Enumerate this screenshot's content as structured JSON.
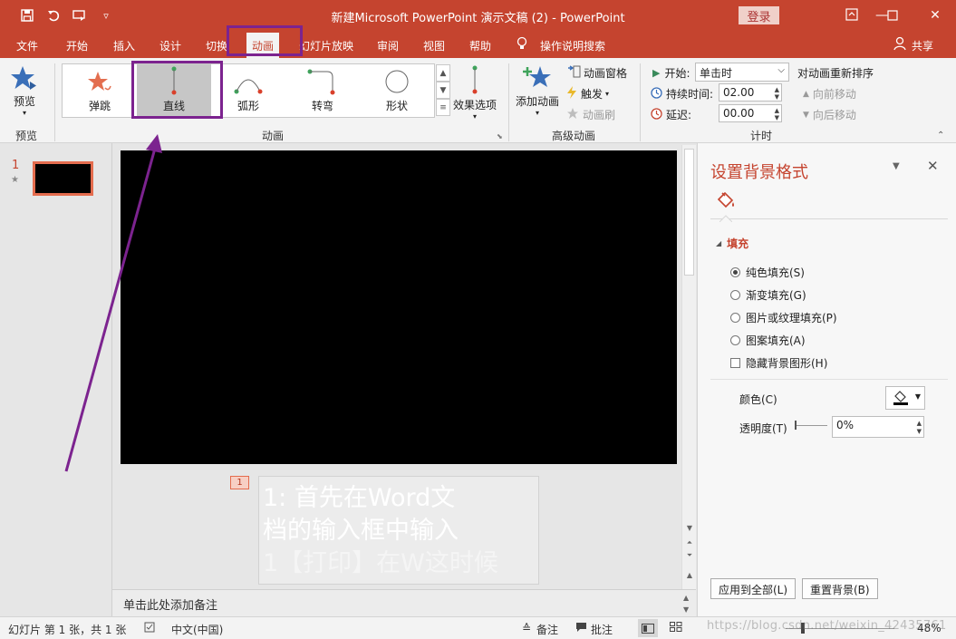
{
  "window": {
    "title": "新建Microsoft PowerPoint 演示文稿 (2)  -  PowerPoint",
    "login_label": "登录",
    "colors": {
      "accent": "#c5442f",
      "highlight": "#7c238f"
    }
  },
  "tabs": {
    "file": "文件",
    "home": "开始",
    "insert": "插入",
    "design": "设计",
    "transitions": "切换",
    "animations": "动画",
    "slideshow": "幻灯片放映",
    "review": "审阅",
    "view": "视图",
    "help": "帮助",
    "tell_me": "操作说明搜索",
    "share": "共享"
  },
  "ribbon": {
    "preview": {
      "button": "预览",
      "group": "预览"
    },
    "animation": {
      "group": "动画",
      "items": [
        "弹跳",
        "直线",
        "弧形",
        "转弯",
        "形状"
      ],
      "selected": "直线",
      "effect_options": "效果选项"
    },
    "advanced": {
      "group": "高级动画",
      "add_animation": "添加动画",
      "animation_pane": "动画窗格",
      "trigger": "触发",
      "animation_painter": "动画刷"
    },
    "timing": {
      "group": "计时",
      "start_label": "开始:",
      "start_value": "单击时",
      "duration_label": "持续时间:",
      "duration_value": "02.00",
      "delay_label": "延迟:",
      "delay_value": "00.00",
      "reorder": "对动画重新排序",
      "move_earlier": "向前移动",
      "move_later": "向后移动"
    }
  },
  "thumbs": {
    "number": "1",
    "star": "★"
  },
  "editor": {
    "slide_tag": "1",
    "note_lines": [
      "1: 首先在Word文",
      "档的输入框中输入",
      "1【打印】在W这时候"
    ],
    "notes_placeholder": "单击此处添加备注"
  },
  "format_pane": {
    "title": "设置背景格式",
    "section": "填充",
    "options": [
      "纯色填充(S)",
      "渐变填充(G)",
      "图片或纹理填充(P)",
      "图案填充(A)"
    ],
    "selected_option": "纯色填充(S)",
    "hide_bg": "隐藏背景图形(H)",
    "color_label": "颜色(C)",
    "transparency_label": "透明度(T)",
    "transparency_value": "0%",
    "apply_all": "应用到全部(L)",
    "reset_bg": "重置背景(B)"
  },
  "status": {
    "slide_info": "幻灯片 第 1 张，共 1 张",
    "language": "中文(中国)",
    "notes": "备注",
    "comments": "批注",
    "zoom": "48%",
    "watermark": "https://blog.csdn.net/weixin_42435761"
  }
}
